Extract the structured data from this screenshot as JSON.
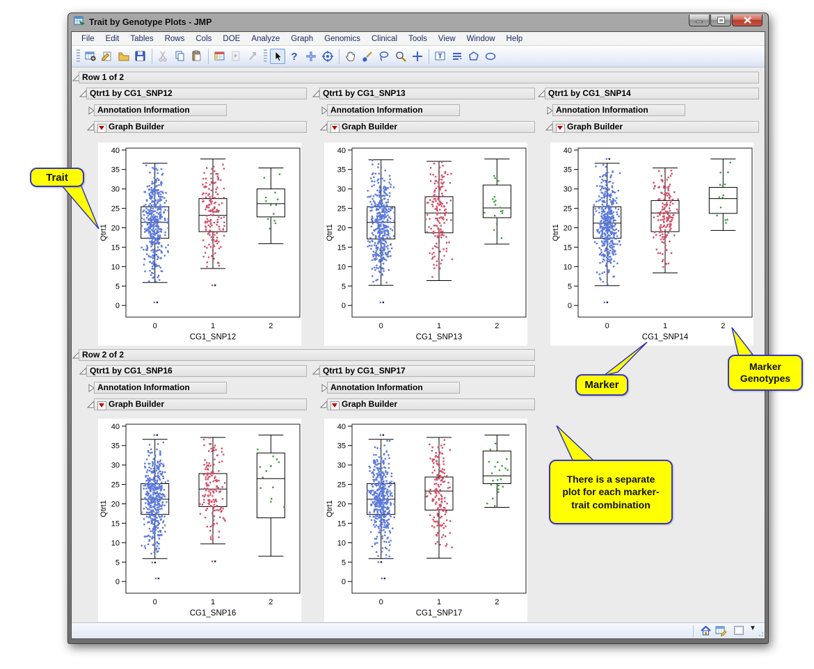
{
  "window": {
    "title": "Trait by Genotype Plots - JMP"
  },
  "menu": {
    "items": [
      "File",
      "Edit",
      "Tables",
      "Rows",
      "Cols",
      "DOE",
      "Analyze",
      "Graph",
      "Genomics",
      "Clinical",
      "Tools",
      "View",
      "Window",
      "Help"
    ]
  },
  "toolbar": {
    "left_icons": [
      "new-data-table",
      "new-journal",
      "open",
      "save",
      "cut",
      "copy",
      "paste",
      "data-grid",
      "run-script",
      "play"
    ],
    "right_icons": [
      "arrow-select",
      "help",
      "mover",
      "bullseye",
      "hand-grabber",
      "brush",
      "lasso",
      "magnifier",
      "crosshair",
      "annotate-text",
      "scroller",
      "polygon",
      "simple-shape"
    ]
  },
  "outline": {
    "row1_label": "Row 1 of 2",
    "row2_label": "Row 2 of 2"
  },
  "panel_labels": {
    "annotation": "Annotation Information",
    "graph_builder": "Graph Builder"
  },
  "panels": [
    {
      "title": "Qtrt1 by CG1_SNP12"
    },
    {
      "title": "Qtrt1 by CG1_SNP13"
    },
    {
      "title": "Qtrt1 by CG1_SNP14"
    },
    {
      "title": "Qtrt1 by CG1_SNP16"
    },
    {
      "title": "Qtrt1 by CG1_SNP17"
    }
  ],
  "callouts": {
    "trait": "Trait",
    "marker": "Marker",
    "marker_genotypes": "Marker Genotypes",
    "separate_plot": "There is a separate plot for each marker-trait combination"
  },
  "status": {
    "icons": [
      "home",
      "table-edit",
      "window-box",
      "dropdown-arrow"
    ]
  },
  "chart_data": [
    {
      "type": "boxplot",
      "title": "Qtrt1 by CG1_SNP12",
      "xlabel": "CG1_SNP12",
      "ylabel": "Qtrt1",
      "ylim": [
        0,
        40
      ],
      "yticks": [
        0,
        5,
        10,
        15,
        20,
        25,
        30,
        35,
        40
      ],
      "categories": [
        "0",
        "1",
        "2"
      ],
      "colors": [
        "#5b79db",
        "#cf5068",
        "#3f9e3f"
      ],
      "groups": [
        {
          "category": "0",
          "n": 430,
          "q1": 17.3,
          "median": 21.4,
          "q3": 25.4,
          "low": 5.9,
          "high": 36.6,
          "outliers": [
            0.8
          ]
        },
        {
          "category": "1",
          "n": 165,
          "q1": 19.0,
          "median": 23.2,
          "q3": 27.5,
          "low": 9.5,
          "high": 37.7,
          "outliers": [
            5.2
          ]
        },
        {
          "category": "2",
          "n": 13,
          "q1": 22.8,
          "median": 26.2,
          "q3": 30.0,
          "low": 15.9,
          "high": 35.4,
          "outliers": []
        }
      ]
    },
    {
      "type": "boxplot",
      "title": "Qtrt1 by CG1_SNP13",
      "xlabel": "CG1_SNP13",
      "ylabel": "Qtrt1",
      "ylim": [
        0,
        40
      ],
      "yticks": [
        0,
        5,
        10,
        15,
        20,
        25,
        30,
        35,
        40
      ],
      "categories": [
        "0",
        "1",
        "2"
      ],
      "colors": [
        "#5b79db",
        "#cf5068",
        "#3f9e3f"
      ],
      "groups": [
        {
          "category": "0",
          "n": 430,
          "q1": 17.1,
          "median": 21.4,
          "q3": 25.4,
          "low": 5.2,
          "high": 37.5,
          "outliers": [
            0.8
          ]
        },
        {
          "category": "1",
          "n": 165,
          "q1": 18.7,
          "median": 23.8,
          "q3": 28.0,
          "low": 6.4,
          "high": 37.1,
          "outliers": []
        },
        {
          "category": "2",
          "n": 17,
          "q1": 22.6,
          "median": 25.1,
          "q3": 31.0,
          "low": 15.8,
          "high": 37.7,
          "outliers": []
        }
      ]
    },
    {
      "type": "boxplot",
      "title": "Qtrt1 by CG1_SNP14",
      "xlabel": "CG1_SNP14",
      "ylabel": "Qtrt1",
      "ylim": [
        0,
        40
      ],
      "yticks": [
        0,
        5,
        10,
        15,
        20,
        25,
        30,
        35,
        40
      ],
      "categories": [
        "0",
        "1",
        "2"
      ],
      "colors": [
        "#5b79db",
        "#cf5068",
        "#3f9e3f"
      ],
      "groups": [
        {
          "category": "0",
          "n": 430,
          "q1": 17.3,
          "median": 21.2,
          "q3": 25.4,
          "low": 5.1,
          "high": 36.6,
          "outliers": [
            37.7,
            0.8
          ]
        },
        {
          "category": "1",
          "n": 160,
          "q1": 19.0,
          "median": 23.8,
          "q3": 27.0,
          "low": 8.4,
          "high": 35.4,
          "outliers": []
        },
        {
          "category": "2",
          "n": 14,
          "q1": 23.7,
          "median": 27.5,
          "q3": 30.4,
          "low": 19.3,
          "high": 37.7,
          "outliers": []
        }
      ]
    },
    {
      "type": "boxplot",
      "title": "Qtrt1 by CG1_SNP16",
      "xlabel": "CG1_SNP16",
      "ylabel": "Qtrt1",
      "ylim": [
        0,
        40
      ],
      "yticks": [
        0,
        5,
        10,
        15,
        20,
        25,
        30,
        35,
        40
      ],
      "categories": [
        "0",
        "1",
        "2"
      ],
      "colors": [
        "#5b79db",
        "#cf5068",
        "#3f9e3f"
      ],
      "groups": [
        {
          "category": "0",
          "n": 430,
          "q1": 17.3,
          "median": 21.2,
          "q3": 25.2,
          "low": 5.9,
          "high": 36.6,
          "outliers": [
            37.7,
            4.9,
            0.8
          ]
        },
        {
          "category": "1",
          "n": 160,
          "q1": 19.3,
          "median": 23.8,
          "q3": 27.8,
          "low": 9.7,
          "high": 37.1,
          "outliers": [
            5.2
          ]
        },
        {
          "category": "2",
          "n": 14,
          "q1": 16.4,
          "median": 26.5,
          "q3": 33.1,
          "low": 6.5,
          "high": 37.7,
          "outliers": []
        }
      ]
    },
    {
      "type": "boxplot",
      "title": "Qtrt1 by CG1_SNP17",
      "xlabel": "CG1_SNP17",
      "ylabel": "Qtrt1",
      "ylim": [
        0,
        40
      ],
      "yticks": [
        0,
        5,
        10,
        15,
        20,
        25,
        30,
        35,
        40
      ],
      "categories": [
        "0",
        "1",
        "2"
      ],
      "colors": [
        "#5b79db",
        "#cf5068",
        "#3f9e3f"
      ],
      "groups": [
        {
          "category": "0",
          "n": 430,
          "q1": 17.3,
          "median": 21.2,
          "q3": 25.2,
          "low": 5.9,
          "high": 36.6,
          "outliers": [
            37.7,
            5.0,
            0.8
          ]
        },
        {
          "category": "1",
          "n": 170,
          "q1": 18.4,
          "median": 23.3,
          "q3": 26.9,
          "low": 6.0,
          "high": 37.1,
          "outliers": []
        },
        {
          "category": "2",
          "n": 25,
          "q1": 25.2,
          "median": 27.2,
          "q3": 33.6,
          "low": 19.1,
          "high": 37.7,
          "outliers": []
        }
      ]
    }
  ]
}
